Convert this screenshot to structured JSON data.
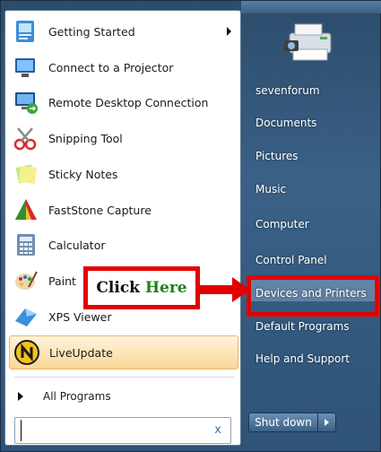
{
  "programs": [
    {
      "label": "Getting Started",
      "icon": "getting-started-icon",
      "submenu": true
    },
    {
      "label": "Connect to a Projector",
      "icon": "projector-icon"
    },
    {
      "label": "Remote Desktop Connection",
      "icon": "remote-desktop-icon"
    },
    {
      "label": "Snipping Tool",
      "icon": "scissors-icon"
    },
    {
      "label": "Sticky Notes",
      "icon": "sticky-notes-icon"
    },
    {
      "label": "FastStone Capture",
      "icon": "faststone-icon"
    },
    {
      "label": "Calculator",
      "icon": "calculator-icon"
    },
    {
      "label": "Paint",
      "icon": "paint-palette-icon"
    },
    {
      "label": "XPS Viewer",
      "icon": "xps-viewer-icon"
    },
    {
      "label": "LiveUpdate",
      "icon": "liveupdate-icon",
      "highlighted": true
    }
  ],
  "all_programs": "All Programs",
  "search": {
    "value": "",
    "clear_glyph": "x"
  },
  "right_items": [
    "sevenforum",
    "Documents",
    "Pictures",
    "Music",
    "Computer",
    "Control Panel",
    "Devices and Printers",
    "Default Programs",
    "Help and Support"
  ],
  "shutdown_label": "Shut down",
  "callout": {
    "word1": "Click",
    "word2": "Here"
  },
  "colors": {
    "annotation_red": "#e30000",
    "callout_green": "#208020",
    "menu_blue": "#3b6187",
    "liveupdate_highlight": "#fde4b6"
  }
}
